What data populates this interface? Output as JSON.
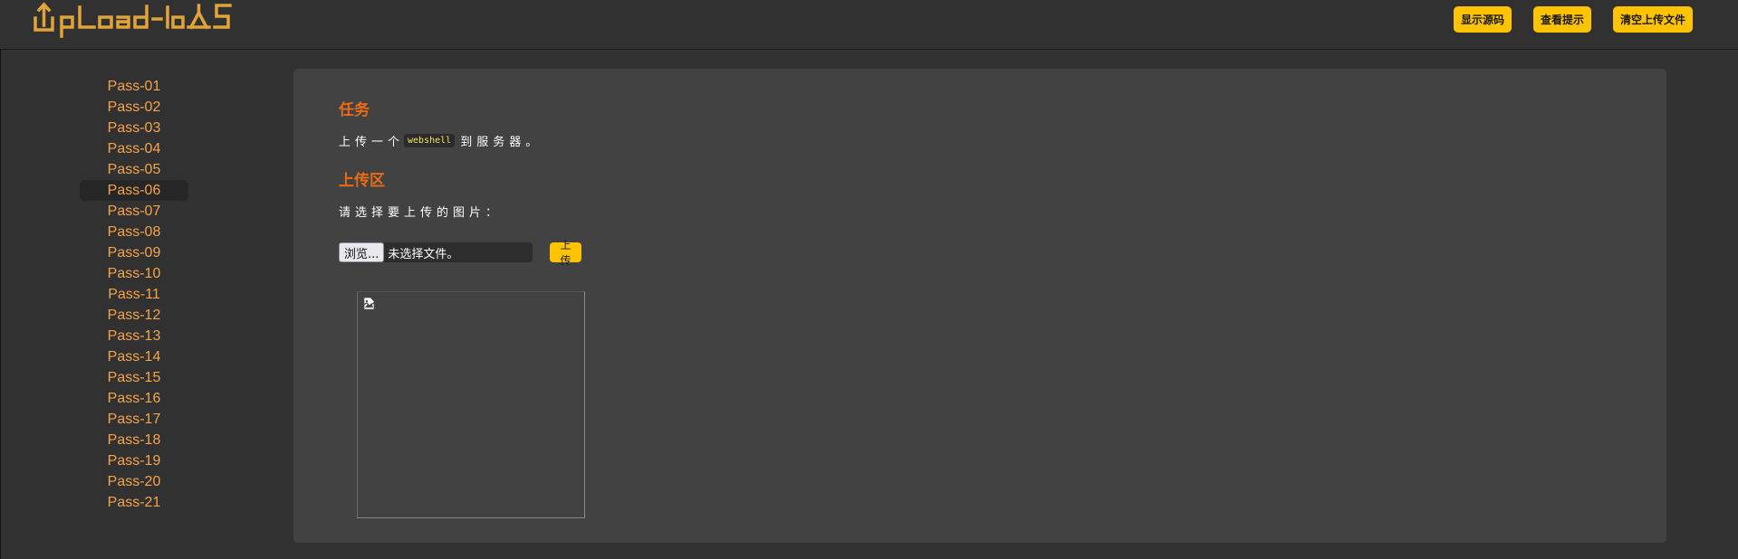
{
  "header": {
    "logo_text": "Upload-labs",
    "buttons": [
      "显示源码",
      "查看提示",
      "清空上传文件"
    ]
  },
  "sidebar": {
    "items": [
      "Pass-01",
      "Pass-02",
      "Pass-03",
      "Pass-04",
      "Pass-05",
      "Pass-06",
      "Pass-07",
      "Pass-08",
      "Pass-09",
      "Pass-10",
      "Pass-11",
      "Pass-12",
      "Pass-13",
      "Pass-14",
      "Pass-15",
      "Pass-16",
      "Pass-17",
      "Pass-18",
      "Pass-19",
      "Pass-20",
      "Pass-21"
    ],
    "active": "Pass-06"
  },
  "main": {
    "task_title": "任务",
    "task_prefix": "上传一个",
    "task_code": "webshell",
    "task_suffix": "到服务器。",
    "upload_title": "上传区",
    "choose_text": "请选择要上传的图片：",
    "browse_label": "浏览...",
    "file_status": "未选择文件。",
    "upload_label": "上传",
    "preview_icon": "broken-image-icon"
  },
  "colors": {
    "accent": "#ffc300",
    "title": "#ea6a16",
    "sidebar_link": "#f5a44a",
    "background": "#313131",
    "panel": "#424242"
  }
}
